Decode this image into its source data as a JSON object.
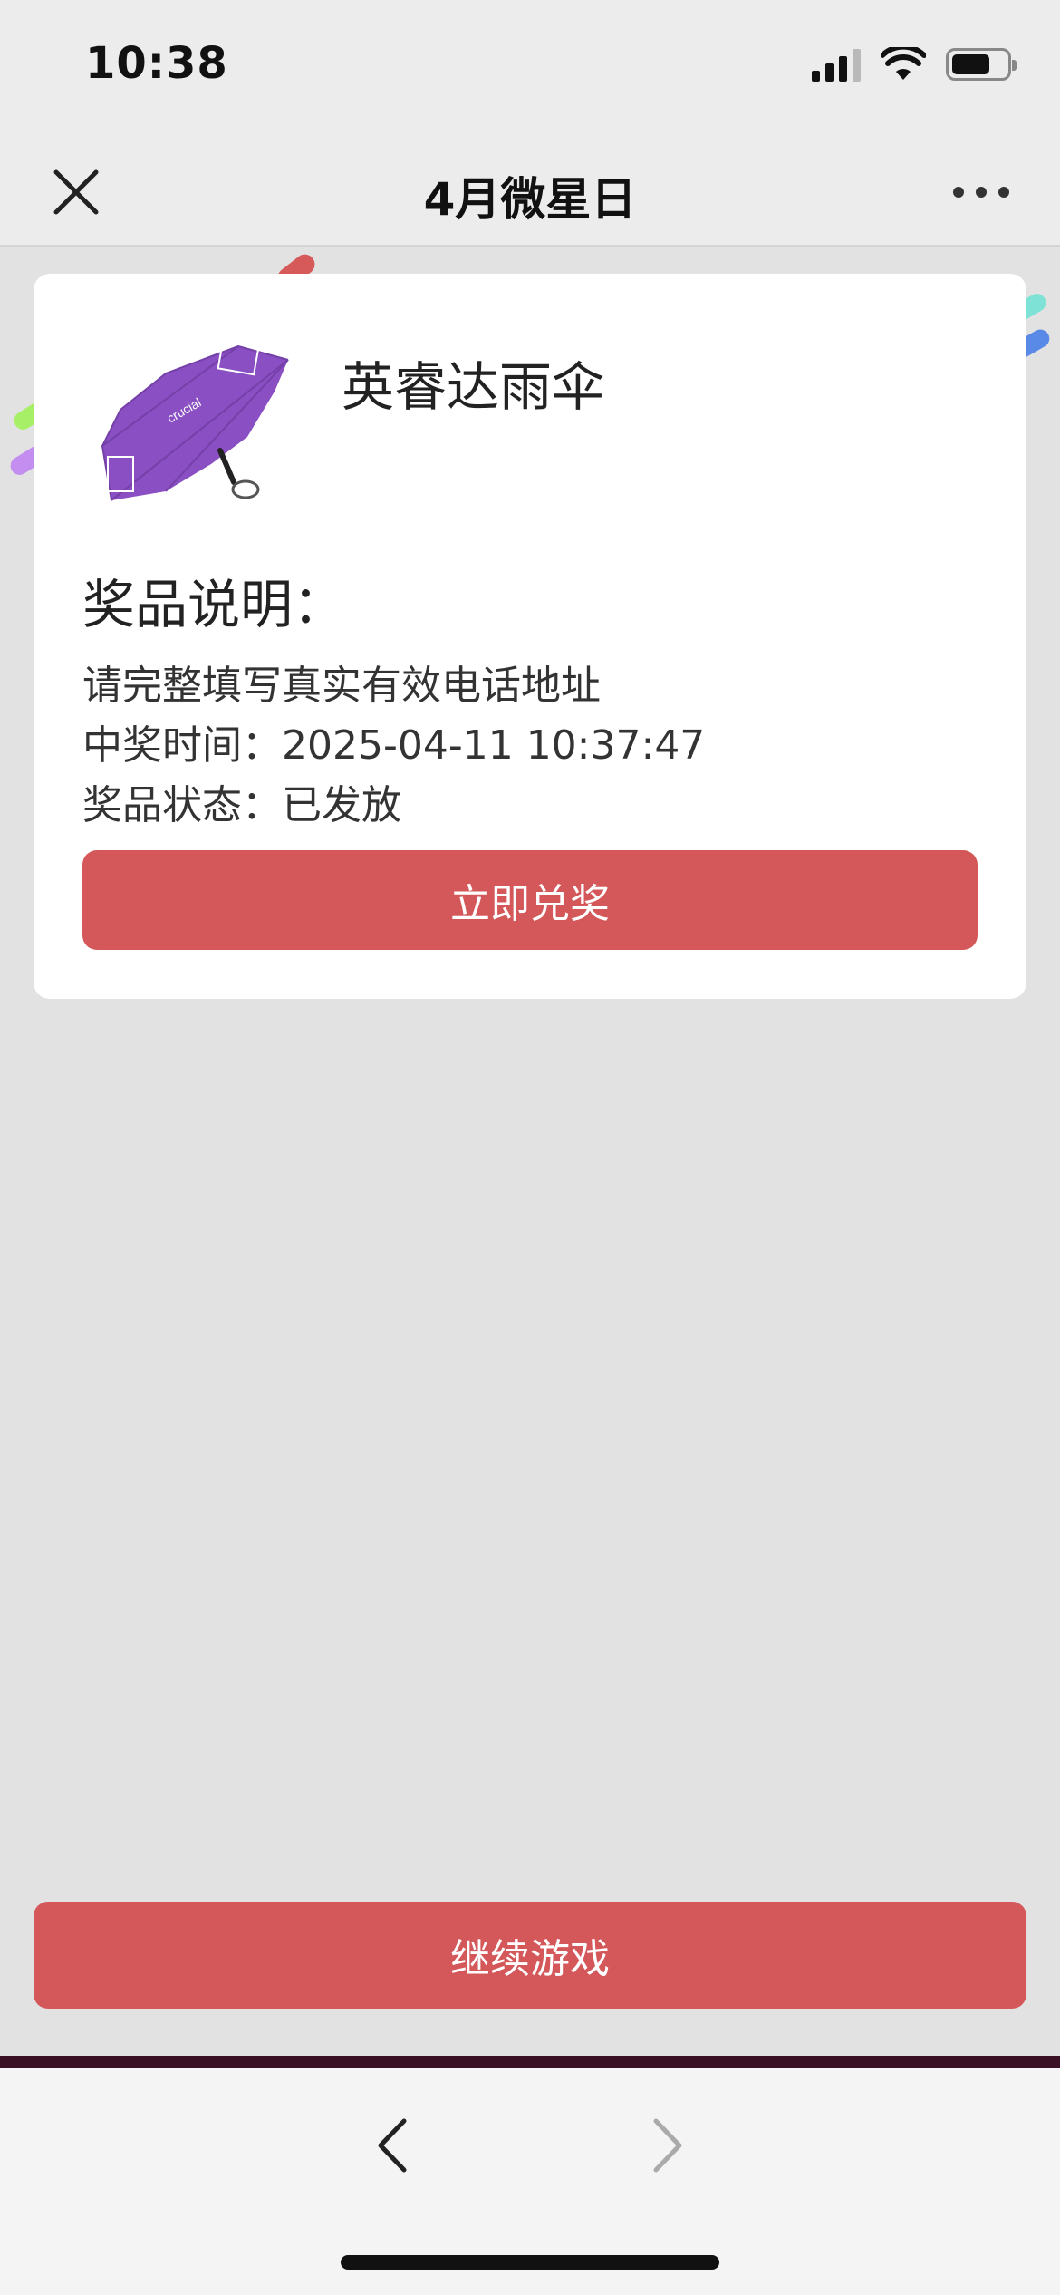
{
  "status_bar": {
    "time": "10:38"
  },
  "nav": {
    "title": "4月微星日",
    "close_icon": "close-icon",
    "more_icon": "more-icon"
  },
  "prize": {
    "name": "英睿达雨伞",
    "image": "purple-umbrella",
    "description_title": "奖品说明：",
    "description": "请完整填写真实有效电话地址",
    "win_time": "中奖时间：2025-04-11 10:37:47",
    "status": "奖品状态：已发放",
    "redeem_label": "立即兑奖"
  },
  "continue_label": "继续游戏",
  "browser": {
    "back_icon": "chevron-left-icon",
    "forward_icon": "chevron-right-icon"
  },
  "colors": {
    "accent": "#d4585a",
    "umbrella": "#8a4fc2",
    "page_bg": "#e2e2e2"
  }
}
